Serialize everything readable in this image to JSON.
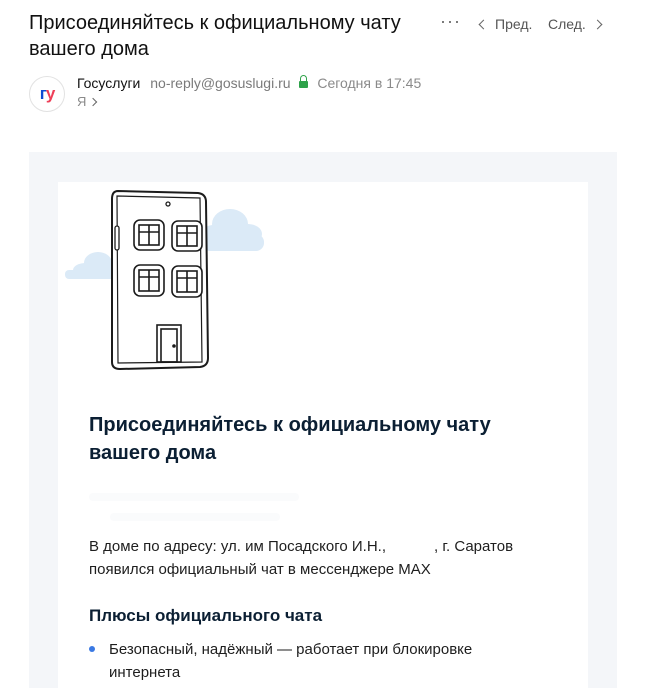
{
  "email": {
    "subject": "Присоединяйтесь к официальному чату вашего дома",
    "sender_name": "Госуслуги",
    "sender_email": "no-reply@gosuslugi.ru",
    "sent_time": "Сегодня в 17:45",
    "recipient": "Я"
  },
  "nav": {
    "more_label": "···",
    "prev_label": "Пред.",
    "next_label": "След."
  },
  "avatar": {
    "letter1": "г",
    "letter2": "у"
  },
  "content": {
    "heading": "Присоединяйтесь к официальному чату вашего дома",
    "address_prefix": "В доме по адресу: ул. им Посадского И.Н.,",
    "address_suffix": ", г. Саратов",
    "body_rest": "появился официальный чат в мессенджере MAX",
    "benefits_heading": "Плюсы официального чата",
    "benefits": [
      "Безопасный, надёжный — работает при блокировке интернета"
    ]
  },
  "colors": {
    "brand_blue": "#0d4cd3",
    "brand_red": "#ee3f58",
    "secure_green": "#2ea24a",
    "bullet_blue": "#3a79e3",
    "mail_background": "#f4f6f9"
  },
  "icons": {
    "more": "more-dots-icon",
    "prev": "chevron-left-icon",
    "next": "chevron-right-icon",
    "lock": "lock-icon",
    "recipient": "chevron-right-icon"
  }
}
